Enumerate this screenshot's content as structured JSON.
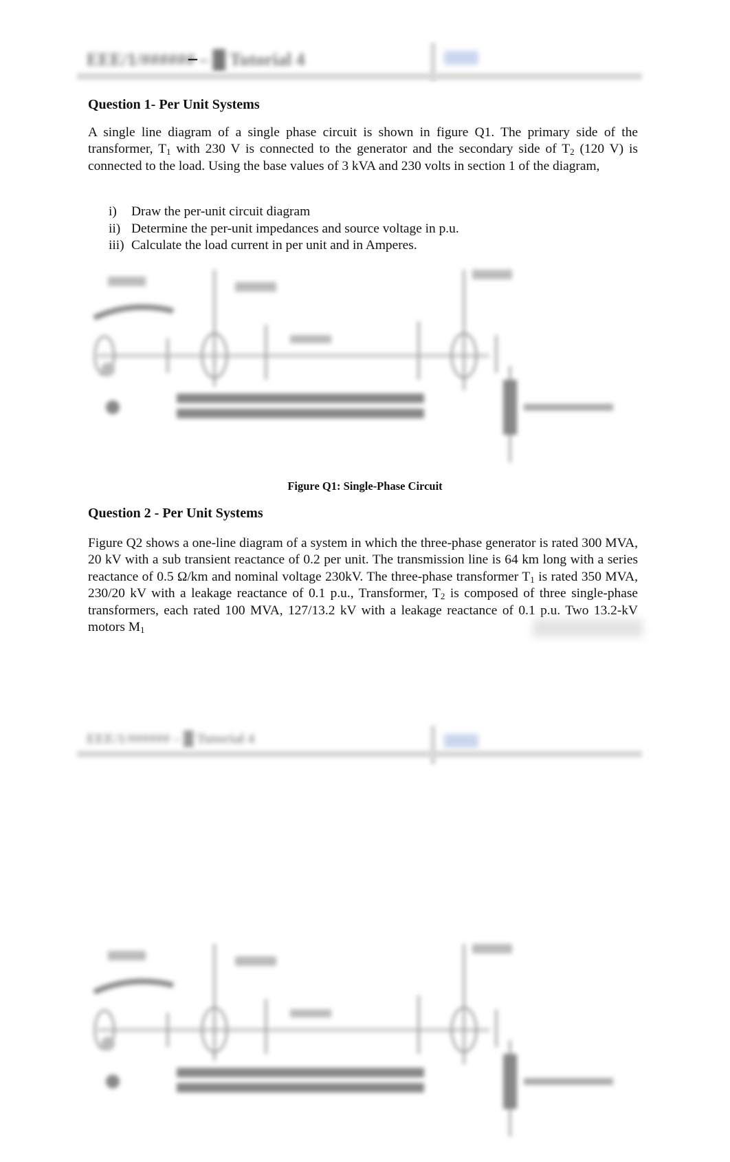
{
  "header": {
    "title_obscured": "EEE/1/######  – █ Tutorial 4",
    "dash": "–",
    "link_obscured": "██ █"
  },
  "question1": {
    "heading": "Question 1- Per Unit Systems",
    "paragraph": {
      "p1": "A single line diagram of a single phase circuit is shown in figure Q1. The primary side of the transformer, T",
      "sub1": "1",
      "p2": " with 230 V is connected to the generator and the secondary side of T",
      "sub2": "2",
      "p3": " (120 V) is connected to the load. Using the base values of 3 kVA and 230 volts in section 1 of the diagram,"
    },
    "tasks": [
      {
        "num": "i)",
        "text": "Draw the per-unit circuit diagram"
      },
      {
        "num": "ii)",
        "text": "Determine the per-unit impedances and source voltage in p.u."
      },
      {
        "num": "iii)",
        "text": "Calculate the load current in per unit and in Amperes."
      }
    ],
    "figure_caption": "Figure Q1: Single-Phase Circuit",
    "figure_obscured": true
  },
  "question2": {
    "heading": "Question 2 - Per Unit Systems",
    "paragraph": {
      "p1": "Figure Q2 shows a one-line diagram of a system in which the three-phase generator is rated 300 MVA, 20 kV with a sub transient reactance of 0.2 per unit. The transmission line is 64 km long with a series reactance of 0.5 Ω/km and nominal voltage 230kV. The three-phase transformer T",
      "sub1": "1",
      "p2": " is rated 350 MVA, 230/20 kV with a leakage reactance of 0.1 p.u., Transformer, T",
      "sub2": "2",
      "p3": " is composed of three single-phase transformers, each rated 100 MVA, 127/13.2 kV with a leakage reactance of 0.1 p.u. Two 13.2-kV motors M",
      "sub3": "1"
    }
  },
  "page2": {
    "header_obscured": true,
    "figure_obscured": true
  }
}
